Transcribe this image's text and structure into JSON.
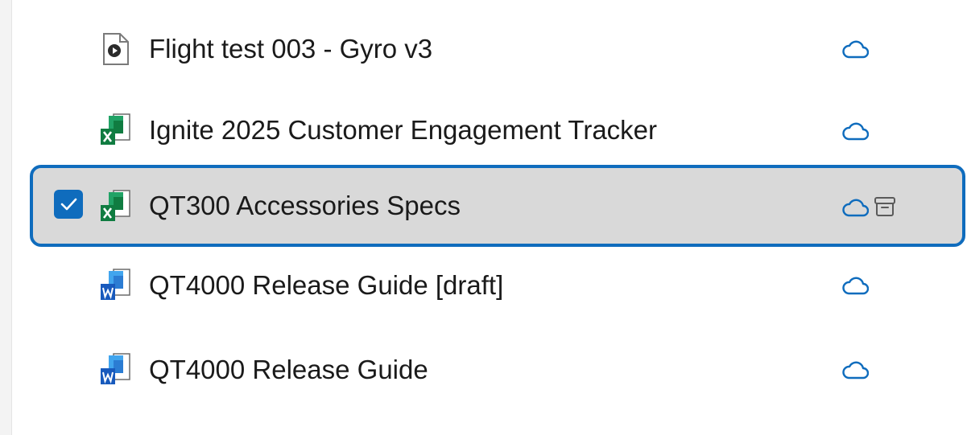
{
  "files": [
    {
      "name": "Flight test 003 - Gyro v3",
      "icon": "video-file-icon",
      "status": "cloud-icon"
    },
    {
      "name": "Ignite 2025 Customer Engagement Tracker",
      "icon": "excel-file-icon",
      "status": "cloud-icon"
    },
    {
      "name": "QT300 Accessories Specs",
      "icon": "excel-file-icon",
      "status": "cloud-icon",
      "selected": true,
      "extra_icon": "archive-icon"
    },
    {
      "name": "QT4000 Release Guide [draft]",
      "icon": "word-file-icon",
      "status": "cloud-icon"
    },
    {
      "name": "QT4000 Release Guide",
      "icon": "word-file-icon",
      "status": "cloud-icon"
    }
  ],
  "colors": {
    "accent": "#0f6cbd",
    "selected_bg": "#d9d9d9",
    "excel_green": "#107c41",
    "word_blue": "#185abd"
  }
}
